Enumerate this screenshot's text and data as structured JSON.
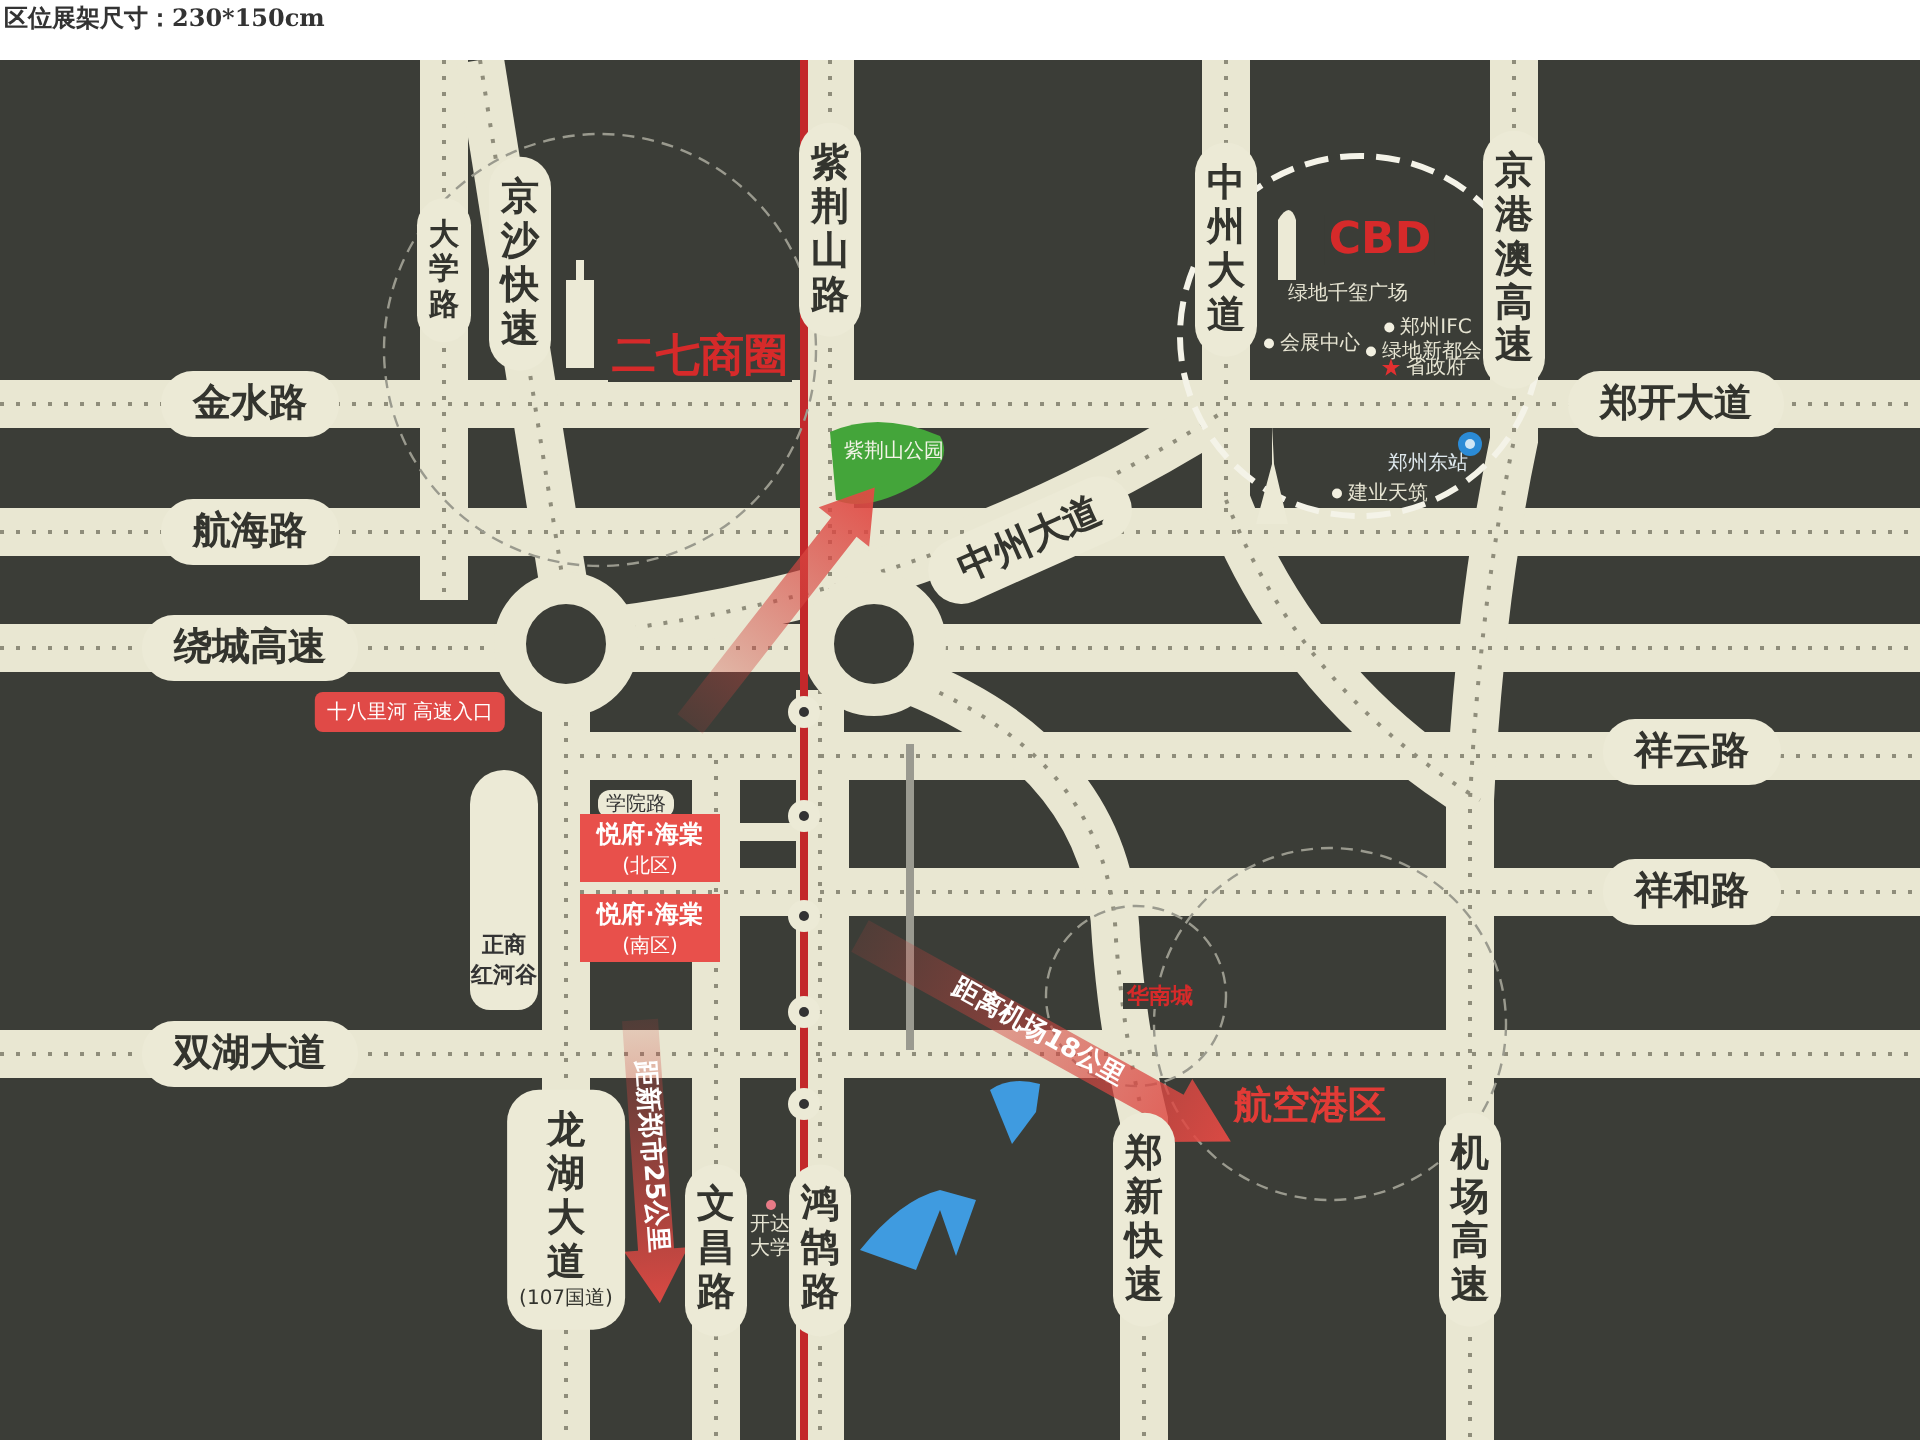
{
  "header": {
    "title": "区位展架尺寸：230*150cm"
  },
  "roads": [
    {
      "name": "金水路",
      "kind": "horizontal"
    },
    {
      "name": "航海路",
      "kind": "horizontal"
    },
    {
      "name": "绕城高速",
      "kind": "horizontal"
    },
    {
      "name": "双湖大道",
      "kind": "horizontal"
    },
    {
      "name": "大学路",
      "kind": "vertical"
    },
    {
      "name": "京沙快速",
      "kind": "vertical"
    },
    {
      "name": "紫荆山路",
      "kind": "vertical"
    },
    {
      "name": "中州大道",
      "kind": "vertical"
    },
    {
      "name": "京港澳高速",
      "kind": "vertical"
    },
    {
      "name": "郑开大道",
      "kind": "horizontal"
    },
    {
      "name": "中州大道",
      "kind": "diagonal"
    },
    {
      "name": "祥云路",
      "kind": "horizontal"
    },
    {
      "name": "祥和路",
      "kind": "horizontal"
    },
    {
      "name": "龙湖大道",
      "kind": "vertical",
      "note": "(107国道)"
    },
    {
      "name": "文昌路",
      "kind": "vertical"
    },
    {
      "name": "鸿鹄路",
      "kind": "vertical"
    },
    {
      "name": "郑新快速",
      "kind": "vertical"
    },
    {
      "name": "机场高速",
      "kind": "vertical"
    }
  ],
  "districts": [
    {
      "name": "二七商圈"
    },
    {
      "name": "CBD"
    },
    {
      "name": "华南城"
    },
    {
      "name": "航空港区"
    }
  ],
  "markers": [
    {
      "kind": "tag",
      "label": "十八里河 高速入口"
    },
    {
      "kind": "pill",
      "label": "学院路"
    },
    {
      "kind": "project",
      "label": "悦府·海棠",
      "sublabel": "(北区)"
    },
    {
      "kind": "project",
      "label": "悦府·海棠",
      "sublabel": "(南区)"
    },
    {
      "kind": "capsule",
      "label": "正商",
      "sublabel": "红河谷"
    }
  ],
  "pois": [
    {
      "kind": "plain",
      "label": "绿地千玺广场"
    },
    {
      "kind": "dot",
      "label": "会展中心"
    },
    {
      "kind": "dot",
      "label": "郑州IFC"
    },
    {
      "kind": "dot",
      "label": "绿地新都会"
    },
    {
      "kind": "star",
      "label": "省政府"
    },
    {
      "kind": "station",
      "label": "郑州东站"
    },
    {
      "kind": "dot",
      "label": "建业天筑"
    },
    {
      "kind": "park",
      "label": "紫荆山公园"
    },
    {
      "kind": "pink",
      "label": "开达大学"
    }
  ],
  "arrows": [
    {
      "label": "距离机场18公里"
    },
    {
      "label": "距新郑市25公里"
    }
  ]
}
